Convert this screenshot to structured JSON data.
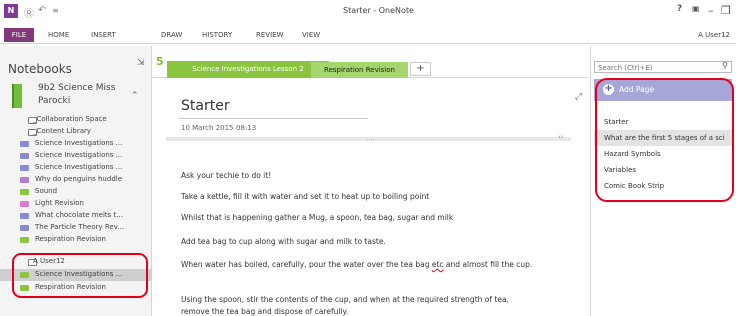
{
  "window": {
    "title": "Starter - OneNote",
    "logo_text": "N",
    "user_name": "A User12"
  },
  "ribbon": {
    "tabs": [
      "FILE",
      "HOME",
      "INSERT",
      "DRAW",
      "HISTORY",
      "REVIEW",
      "VIEW"
    ]
  },
  "nav": {
    "title": "Notebooks",
    "notebook_name_line1": "9b2 Science Miss",
    "notebook_name_line2": "Parocki",
    "section_groups": [
      {
        "label": "_Collaboration Space"
      },
      {
        "label": "_Content Library"
      }
    ],
    "content_library_sections": [
      {
        "label": "Science Investigations ...",
        "color": "#8a8ad0"
      },
      {
        "label": "Science Investigations ...",
        "color": "#8a8ad0"
      },
      {
        "label": "Science Investigations ...",
        "color": "#8a8ad0"
      },
      {
        "label": "Why do penguins huddle",
        "color": "#b57bd2"
      },
      {
        "label": "Sound",
        "color": "#8bc540"
      },
      {
        "label": "Light Revision",
        "color": "#d77bd0"
      },
      {
        "label": "What chocolate melts t...",
        "color": "#8a8ad0"
      },
      {
        "label": "The Particle Theory Rev...",
        "color": "#8a8ad0"
      },
      {
        "label": "Respiration Revision",
        "color": "#8bc540"
      }
    ],
    "user_group": {
      "label": "A User12"
    },
    "user_sections": [
      {
        "label": "Science Investigations ...",
        "color": "#8bc540",
        "selected": true
      },
      {
        "label": "Respiration Revision",
        "color": "#8bc540",
        "selected": false
      }
    ]
  },
  "section_tabs": {
    "active": "Science Investigations Lesson 2",
    "other": "Respiration Revision",
    "add": "+"
  },
  "page": {
    "title": "Starter",
    "date": "10 March 2015",
    "time": "08:13",
    "container_handle": "....",
    "paragraphs": [
      "Ask your techie to do it!",
      "Take a kettle, fill it with water and set it to heat up to boiling point",
      "Whilst that is happening gather a Mug, a spoon, tea bag, sugar and milk",
      "Add tea bag to cup along with sugar and milk to taste."
    ],
    "para5_before": "When water has boiled, carefully, pour the water over the tea bag ",
    "para5_misspelled": "etc",
    "para5_after": " and almost fill the cup.",
    "para6_line1": "Using the spoon, stir the contents of the cup, and when at the required strength of tea,",
    "para6_line2": "remove the tea bag and dispose of carefully."
  },
  "pages_panel": {
    "search_placeholder": "Search (Ctrl+E)",
    "add_page_label": "Add Page",
    "pages": [
      {
        "label": "Starter",
        "selected": false
      },
      {
        "label": "What are the first 5 stages of a sci",
        "selected": true
      },
      {
        "label": "Hazard Symbols",
        "selected": false
      },
      {
        "label": "Variables",
        "selected": false
      },
      {
        "label": "Comic Book Strip",
        "selected": false
      }
    ]
  }
}
